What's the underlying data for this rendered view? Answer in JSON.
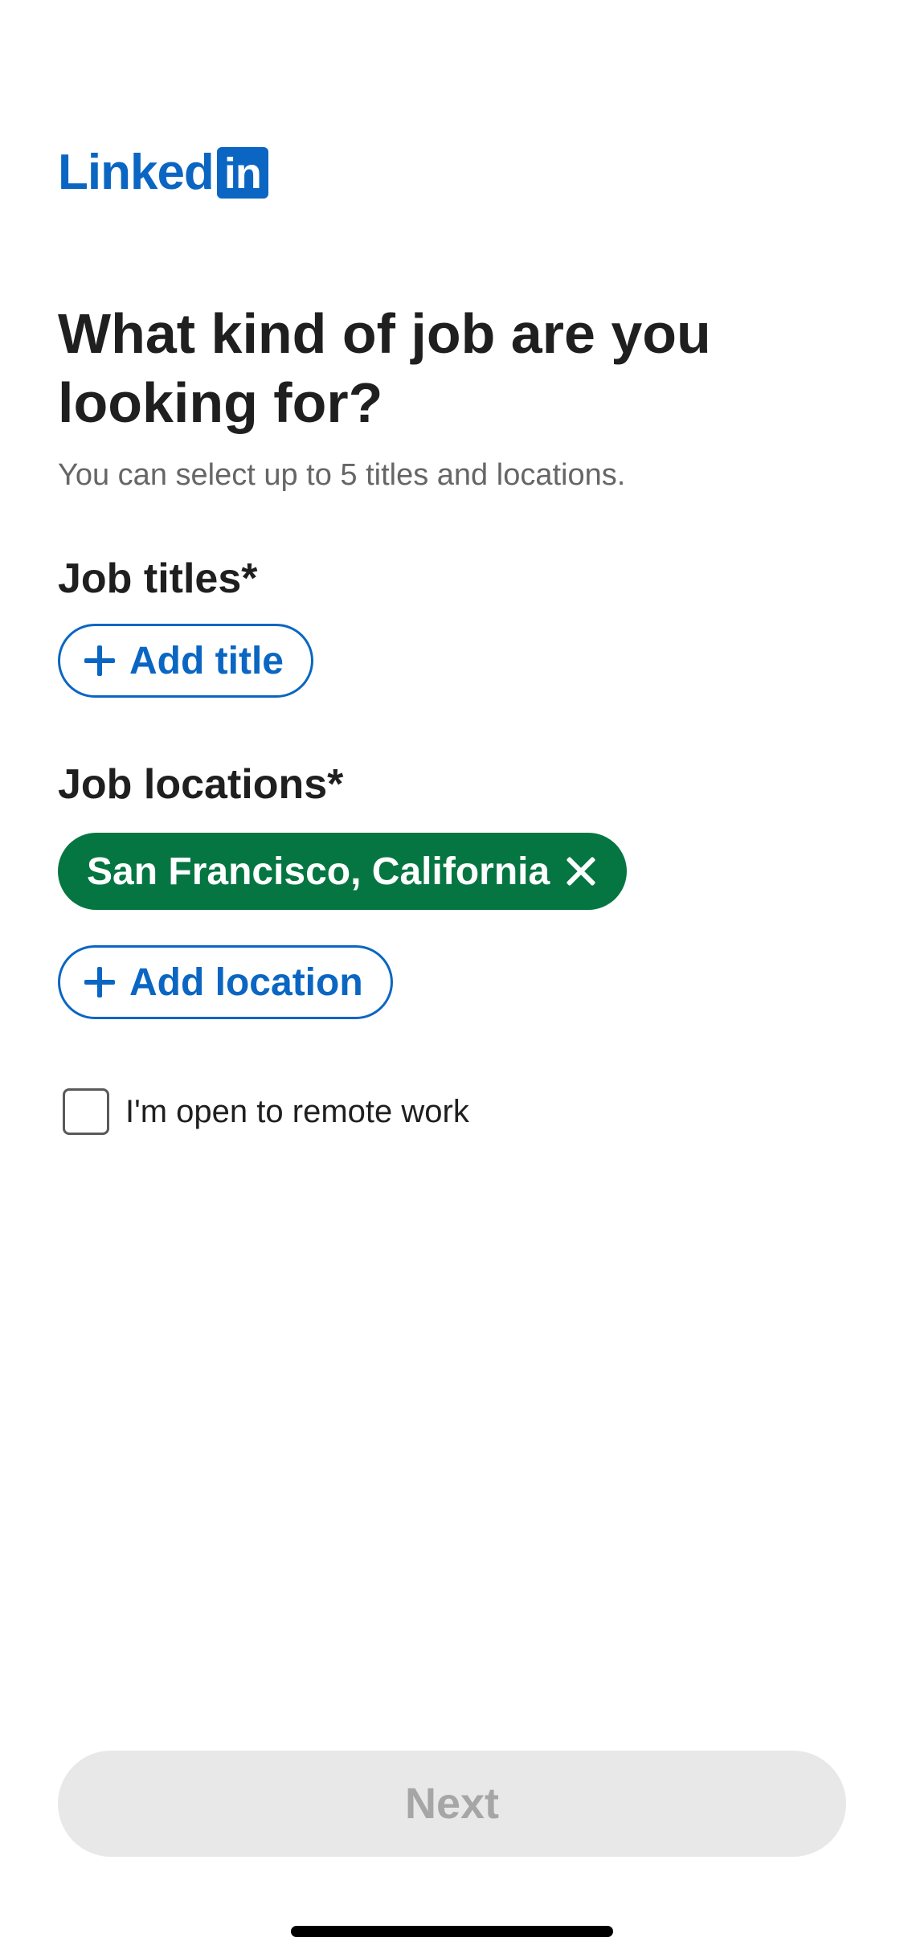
{
  "logo": {
    "text": "Linked",
    "box_text": "in",
    "brand_color": "#0a66c2"
  },
  "page": {
    "heading": "What kind of job are you looking for?",
    "subtext": "You can select up to 5 titles and locations."
  },
  "job_titles": {
    "label": "Job titles*",
    "add_button_label": "Add title"
  },
  "job_locations": {
    "label": "Job locations*",
    "selected": [
      "San Francisco, California"
    ],
    "chip_color": "#057642",
    "add_button_label": "Add location"
  },
  "remote": {
    "label": "I'm open to remote work",
    "checked": false
  },
  "footer": {
    "next_label": "Next",
    "next_enabled": false
  }
}
